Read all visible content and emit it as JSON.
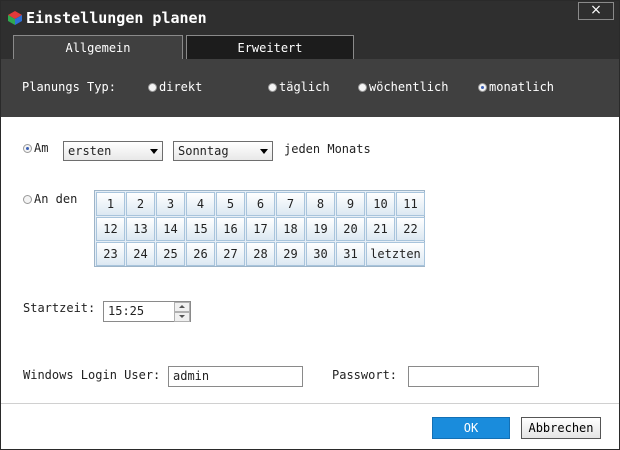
{
  "window": {
    "title": "Einstellungen planen",
    "close_label": "×"
  },
  "tabs": [
    {
      "label": "Allgemein"
    },
    {
      "label": "Erweitert"
    }
  ],
  "plan_type": {
    "label": "Planungs Typ:",
    "options": [
      {
        "label": "direkt"
      },
      {
        "label": "täglich"
      },
      {
        "label": "wöchentlich"
      },
      {
        "label": "monatlich"
      }
    ],
    "selected": "monatlich"
  },
  "am": {
    "label": "Am",
    "ordinal": "ersten",
    "weekday": "Sonntag",
    "suffix": "jeden Monats"
  },
  "an_den": {
    "label": "An den",
    "days": [
      "1",
      "2",
      "3",
      "4",
      "5",
      "6",
      "7",
      "8",
      "9",
      "10",
      "11",
      "12",
      "13",
      "14",
      "15",
      "16",
      "17",
      "18",
      "19",
      "20",
      "21",
      "22",
      "23",
      "24",
      "25",
      "26",
      "27",
      "28",
      "29",
      "30",
      "31",
      "letzten"
    ]
  },
  "start_time": {
    "label": "Startzeit:",
    "value": "15:25"
  },
  "login": {
    "user_label": "Windows Login User:",
    "user_value": "admin",
    "password_label": "Passwort:",
    "password_value": ""
  },
  "buttons": {
    "ok": "OK",
    "cancel": "Abbrechen"
  }
}
